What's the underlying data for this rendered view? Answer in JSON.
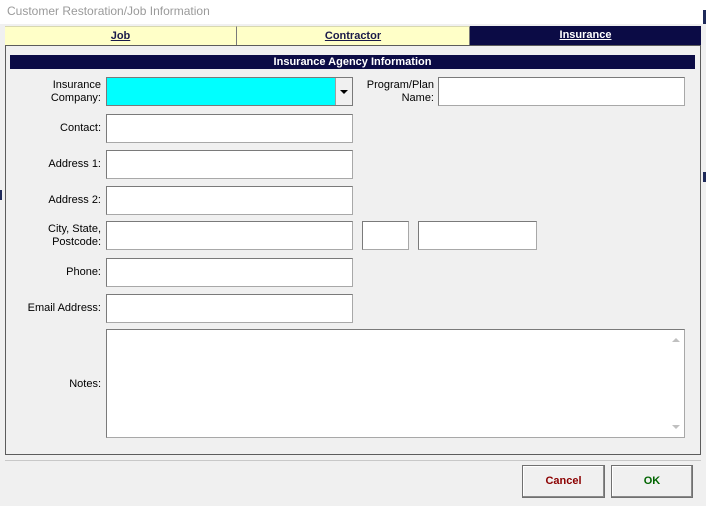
{
  "window": {
    "title": "Customer Restoration/Job Information"
  },
  "tabs": [
    {
      "label": "Job",
      "active": false
    },
    {
      "label": "Contractor",
      "active": false
    },
    {
      "label": "Insurance",
      "active": true
    }
  ],
  "section": {
    "title": "Insurance Agency Information"
  },
  "form": {
    "insurance_company": {
      "label_line1": "Insurance",
      "label_line2": "Company:",
      "value": ""
    },
    "program_plan": {
      "label_line1": "Program/Plan",
      "label_line2": "Name:",
      "value": ""
    },
    "contact": {
      "label": "Contact:",
      "value": ""
    },
    "address1": {
      "label": "Address 1:",
      "value": ""
    },
    "address2": {
      "label": "Address 2:",
      "value": ""
    },
    "city_state_postcode": {
      "label_line1": "City, State,",
      "label_line2": "Postcode:",
      "city": "",
      "state": "",
      "postcode": ""
    },
    "phone": {
      "label": "Phone:",
      "value": ""
    },
    "email": {
      "label": "Email Address:",
      "value": ""
    },
    "notes": {
      "label": "Notes:",
      "value": ""
    }
  },
  "buttons": {
    "cancel": "Cancel",
    "ok": "OK"
  },
  "colors": {
    "header_bg": "#0b0b45",
    "inactive_tab_bg": "#ffffc8",
    "combo_bg": "#00ffff",
    "cancel_text": "#8b0000",
    "ok_text": "#006400"
  }
}
